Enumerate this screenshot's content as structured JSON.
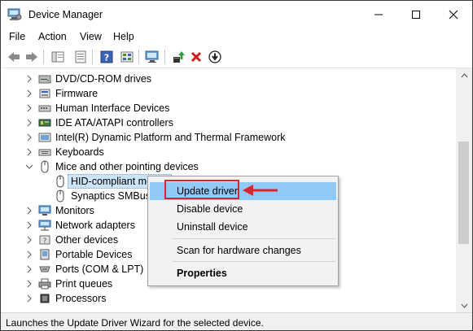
{
  "window": {
    "title": "Device Manager"
  },
  "menu": [
    "File",
    "Action",
    "View",
    "Help"
  ],
  "toolbar": [
    "back-arrow-icon",
    "forward-arrow-icon",
    "show-hide-console-tree-icon",
    "properties-icon",
    "help-icon",
    "view-resources-icon",
    "monitor-scan-icon",
    "update-driver-icon",
    "uninstall-device-icon",
    "download-driver-icon"
  ],
  "tree": [
    {
      "label": "DVD/CD-ROM drives",
      "icon": "dvd-drive-icon",
      "expanded": false,
      "level": 0
    },
    {
      "label": "Firmware",
      "icon": "firmware-icon",
      "expanded": false,
      "level": 0
    },
    {
      "label": "Human Interface Devices",
      "icon": "hid-icon",
      "expanded": false,
      "level": 0
    },
    {
      "label": "IDE ATA/ATAPI controllers",
      "icon": "ide-controller-icon",
      "expanded": false,
      "level": 0
    },
    {
      "label": "Intel(R) Dynamic Platform and Thermal Framework",
      "icon": "intel-framework-icon",
      "expanded": false,
      "level": 0
    },
    {
      "label": "Keyboards",
      "icon": "keyboard-icon",
      "expanded": false,
      "level": 0
    },
    {
      "label": "Mice and other pointing devices",
      "icon": "mouse-icon",
      "expanded": true,
      "level": 0
    },
    {
      "label": "HID-compliant mo",
      "icon": "mouse-icon",
      "level": 1,
      "selected": true
    },
    {
      "label": "Synaptics SMBus T",
      "icon": "mouse-icon",
      "level": 1
    },
    {
      "label": "Monitors",
      "icon": "monitor-icon",
      "expanded": false,
      "level": 0
    },
    {
      "label": "Network adapters",
      "icon": "network-adapter-icon",
      "expanded": false,
      "level": 0
    },
    {
      "label": "Other devices",
      "icon": "other-devices-icon",
      "expanded": false,
      "level": 0
    },
    {
      "label": "Portable Devices",
      "icon": "portable-device-icon",
      "expanded": false,
      "level": 0
    },
    {
      "label": "Ports (COM & LPT)",
      "icon": "ports-icon",
      "expanded": false,
      "level": 0
    },
    {
      "label": "Print queues",
      "icon": "printer-icon",
      "expanded": false,
      "level": 0
    },
    {
      "label": "Processors",
      "icon": "processor-icon",
      "expanded": false,
      "level": 0
    }
  ],
  "context_menu": [
    {
      "label": "Update driver",
      "highlighted": true,
      "bold": false
    },
    {
      "label": "Disable device",
      "bold": false
    },
    {
      "label": "Uninstall device",
      "bold": false
    },
    {
      "label": "Scan for hardware changes",
      "bold": false
    },
    {
      "label": "Properties",
      "bold": true
    }
  ],
  "status": {
    "text": "Launches the Update Driver Wizard for the selected device."
  },
  "colors": {
    "selection": "#cce4f7",
    "menu_highlight": "#91c9f7",
    "annotation": "#d9262a"
  }
}
